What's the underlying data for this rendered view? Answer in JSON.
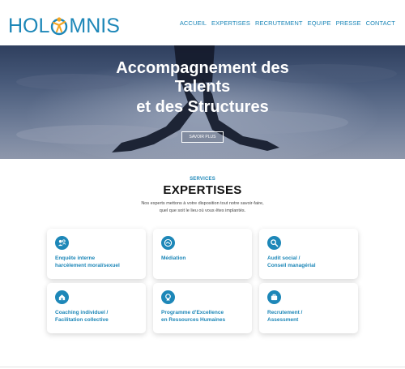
{
  "brand": {
    "logo_left": "HOL",
    "logo_right": "MNIS",
    "primary_color": "#1d87b8",
    "accent_color": "#f5a623"
  },
  "nav": {
    "items": [
      "ACCUEIL",
      "EXPERTISES",
      "RECRUTEMENT",
      "EQUIPE",
      "PRESSE",
      "CONTACT"
    ]
  },
  "hero": {
    "title_line1": "Accompagnement des",
    "title_line2": "Talents",
    "title_line3": "et des Structures",
    "button_label": "SAVOIR PLUS"
  },
  "section": {
    "eyebrow": "SERVICES",
    "title": "EXPERTISES",
    "intro_line1": "Nos experts mettons à votre disposition tout notre savoir-faire,",
    "intro_line2": "quel que soit le lieu où vous êtes implantés."
  },
  "cards": [
    {
      "icon": "people-icon",
      "line1": "Enquête interne",
      "line2": "harcèlement moral/sexuel"
    },
    {
      "icon": "handshake-icon",
      "line1": "Médiation",
      "line2": ""
    },
    {
      "icon": "magnifier-icon",
      "line1": "Audit social /",
      "line2": "Conseil managérial"
    },
    {
      "icon": "house-icon",
      "line1": "Coaching individuel /",
      "line2": "Facilitation collective"
    },
    {
      "icon": "medal-icon",
      "line1": "Programme d'Excellence",
      "line2": "en Ressources Humaines"
    },
    {
      "icon": "briefcase-icon",
      "line1": "Recrutement /",
      "line2": "Assessment"
    }
  ]
}
